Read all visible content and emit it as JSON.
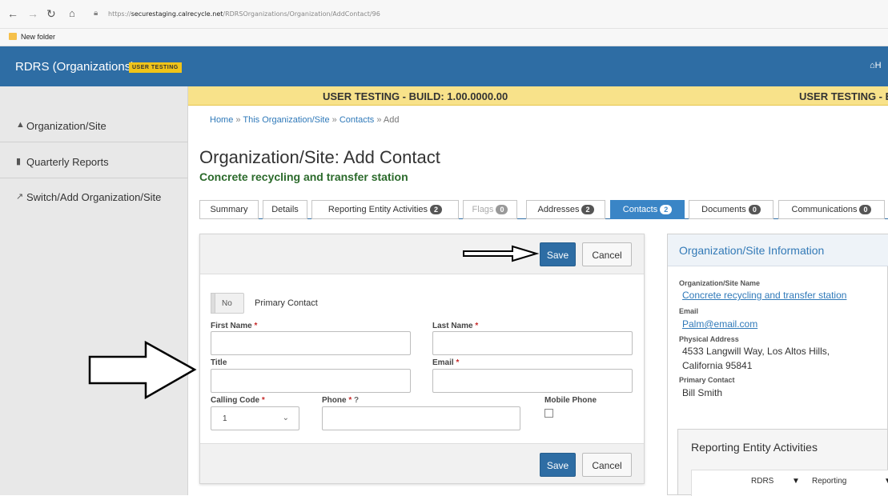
{
  "browser": {
    "url_prefix": "https://",
    "url_host": "securestaging.calrecycle.net",
    "url_path": "/RDRSOrganizations/Organization/AddContact/96",
    "bookmark": "New folder"
  },
  "header": {
    "app_title": "RDRS (Organizations)",
    "badge": "USER TESTING",
    "home_text": "H"
  },
  "sidebar": {
    "items": [
      {
        "label": "Organization/Site",
        "icon": "user-icon"
      },
      {
        "label": "Quarterly Reports",
        "icon": "bar-chart-icon"
      },
      {
        "label": "Switch/Add Organization/Site",
        "icon": "external-link-icon"
      }
    ]
  },
  "banner": {
    "text": "USER TESTING - BUILD: 1.00.0000.00",
    "text_repeat": "USER TESTING - BU"
  },
  "breadcrumb": {
    "home": "Home",
    "org": "This Organization/Site",
    "contacts": "Contacts",
    "current": "Add",
    "separator": "»"
  },
  "page": {
    "title": "Organization/Site: Add Contact",
    "subtitle": "Concrete recycling and transfer station"
  },
  "tabs": [
    {
      "label": "Summary",
      "count": ""
    },
    {
      "label": "Details",
      "count": ""
    },
    {
      "label": "Reporting Entity Activities",
      "count": "2"
    },
    {
      "label": "Flags",
      "count": "0"
    },
    {
      "label": "Addresses",
      "count": "2"
    },
    {
      "label": "Contacts",
      "count": "2"
    },
    {
      "label": "Documents",
      "count": "0"
    },
    {
      "label": "Communications",
      "count": "0"
    }
  ],
  "form": {
    "save_label": "Save",
    "cancel_label": "Cancel",
    "toggle_value": "No",
    "primary_contact_label": "Primary Contact",
    "first_name_label": "First Name",
    "last_name_label": "Last Name",
    "title_label": "Title",
    "email_label": "Email",
    "calling_code_label": "Calling Code",
    "calling_code_value": "1",
    "phone_label": "Phone",
    "mobile_phone_label": "Mobile Phone",
    "required_mark": "*",
    "help_icon": "question-circle-icon"
  },
  "info": {
    "title": "Organization/Site Information",
    "name_label": "Organization/Site Name",
    "name_value": "Concrete recycling and transfer station",
    "email_label": "Email",
    "email_value": "Palm@email.com",
    "address_label": "Physical Address",
    "address_line1": "4533 Langwill Way, Los Altos Hills,",
    "address_line2": "California 95841",
    "primary_label": "Primary Contact",
    "primary_value": "Bill Smith",
    "activities_title": "Reporting Entity Activities",
    "col1": "RDRS",
    "col2": "Reporting"
  }
}
